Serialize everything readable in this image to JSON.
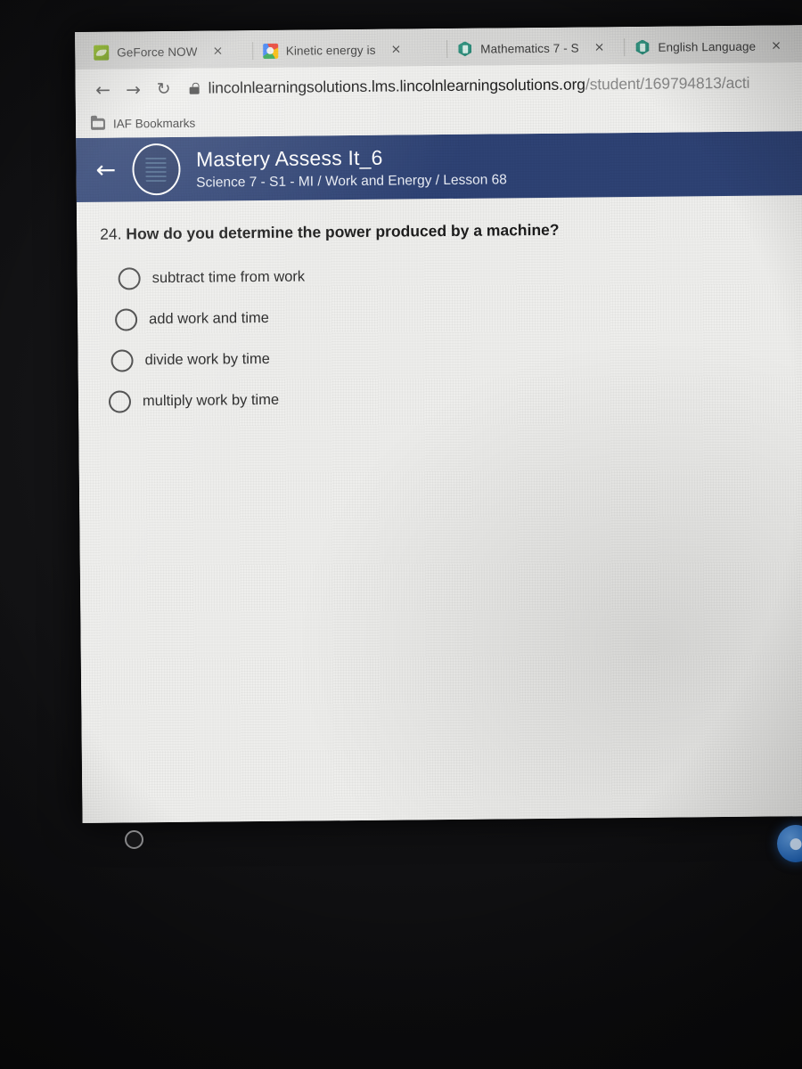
{
  "browser": {
    "tabs": [
      {
        "title": "GeForce NOW",
        "favicon": "geforce-icon",
        "close_label": "×"
      },
      {
        "title": "Kinetic energy is",
        "favicon": "google-icon",
        "close_label": "×"
      },
      {
        "title": "Mathematics 7 - S",
        "favicon": "lincoln-icon",
        "close_label": "×"
      },
      {
        "title": "English Language",
        "favicon": "lincoln-icon",
        "close_label": "×"
      }
    ],
    "toolbar": {
      "back_glyph": "←",
      "forward_glyph": "→",
      "reload_glyph": "↻",
      "lock_icon": "lock-icon"
    },
    "omnibox": {
      "url_domain": "lincolnlearningsolutions.lms.lincolnlearningsolutions.org",
      "url_path": "/student/169794813/acti"
    },
    "bookmarks": [
      {
        "label": "IAF Bookmarks",
        "icon": "folder-icon"
      }
    ]
  },
  "lms": {
    "header": {
      "back_glyph": "←",
      "badge_icon": "course-badge-icon",
      "title": "Mastery Assess It_6",
      "subtitle": "Science 7 - S1 - MI / Work and Energy / Lesson 68",
      "accent_color": "#2e4274"
    },
    "question": {
      "number": "24.",
      "text": "How do you determine the power produced by a machine?",
      "options": [
        {
          "label": "subtract time from work",
          "selected": false
        },
        {
          "label": "add work and time",
          "selected": false
        },
        {
          "label": "divide work by time",
          "selected": false
        },
        {
          "label": "multiply work by time",
          "selected": false
        }
      ]
    },
    "footer": {
      "history_icon": "clock-icon"
    },
    "corner_action": {
      "icon": "chat-bubble-icon",
      "glyph": "●",
      "color": "#1f62b5"
    }
  },
  "device": {
    "bezel_button": "power-indicator-button"
  }
}
